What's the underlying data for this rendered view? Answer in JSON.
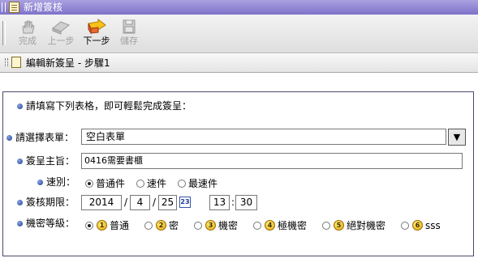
{
  "window": {
    "title": "新增簽核"
  },
  "toolbar": {
    "complete_label": "完成",
    "prev_label": "上一步",
    "next_label": "下一步",
    "save_label": "儲存"
  },
  "subheader": {
    "title": "編輯新簽呈 - 步驟1"
  },
  "form": {
    "intro": "請填寫下列表格，即可輕鬆完成簽呈：",
    "form_select_label": "請選擇表單：",
    "form_select_value": "空白表單",
    "dropdown_glyph": "▼",
    "subject_label": "簽呈主旨：",
    "subject_value": "0416需要書櫃",
    "speed_label": "速別：",
    "speed_options": [
      "普通件",
      "速件",
      "最速件"
    ],
    "speed_selected": "普通件",
    "deadline_label": "簽核期限：",
    "deadline": {
      "year": "2014",
      "month": "4",
      "day": "25",
      "hour": "13",
      "minute": "30"
    },
    "date_sep": "/",
    "time_sep": ":",
    "calendar_glyph": "23",
    "secrecy_label": "機密等級：",
    "secrecy_options": [
      {
        "num": "1",
        "label": "普通"
      },
      {
        "num": "2",
        "label": "密"
      },
      {
        "num": "3",
        "label": "機密"
      },
      {
        "num": "4",
        "label": "極機密"
      },
      {
        "num": "5",
        "label": "絕對機密"
      },
      {
        "num": "6",
        "label": "sss"
      }
    ],
    "secrecy_selected": "普通"
  }
}
